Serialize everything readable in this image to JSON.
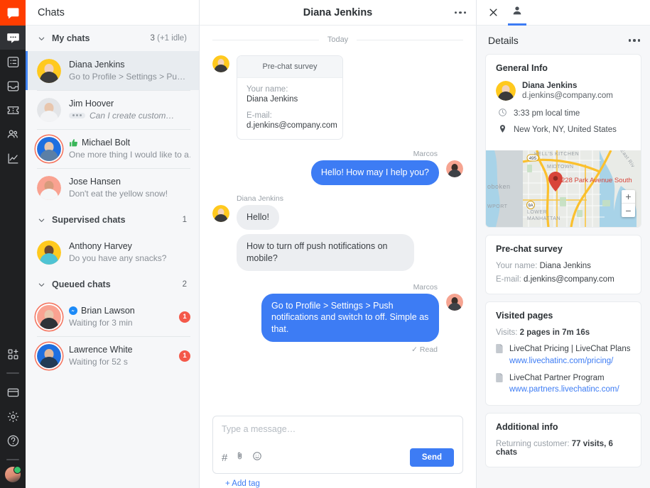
{
  "rail": {
    "logo_icon": "livechat-logo-icon",
    "items": [
      {
        "icon": "chats-bubble-icon",
        "name": "rail-item-chats",
        "active": true
      },
      {
        "icon": "list-icon",
        "name": "rail-item-archives",
        "active": false
      },
      {
        "icon": "inbox-tray-icon",
        "name": "rail-item-tickets",
        "active": false
      },
      {
        "icon": "ticket-icon",
        "name": "rail-item-tickets-2",
        "active": false
      },
      {
        "icon": "people-icon",
        "name": "rail-item-traffic",
        "active": false
      },
      {
        "icon": "chart-line-icon",
        "name": "rail-item-reports",
        "active": false
      }
    ],
    "bottom_items": [
      {
        "icon": "add-apps-icon",
        "name": "rail-item-apps"
      },
      {
        "icon": "card-icon",
        "name": "rail-item-billing"
      },
      {
        "icon": "gear-icon",
        "name": "rail-item-settings"
      },
      {
        "icon": "question-circle-icon",
        "name": "rail-item-help"
      }
    ],
    "avatar_status": "online"
  },
  "chatlist": {
    "header": "Chats",
    "groups": [
      {
        "title": "My chats",
        "count": "3",
        "count_muted": "(+1 idle)",
        "rows": [
          {
            "name": "Diana Jenkins",
            "preview": "Go to Profile > Settings > Pu…",
            "selected": true,
            "ring": false,
            "typing": false,
            "badge": null,
            "prefix_icon": null,
            "av_bg": "#ffc91e",
            "av_face": "#f2d2bb",
            "av_body": "#3b3b3b"
          },
          {
            "name": "Jim Hoover",
            "preview": "Can I create custom…",
            "selected": false,
            "ring": false,
            "typing": true,
            "badge": null,
            "prefix_icon": null,
            "av_bg": "#e3e5e8",
            "av_face": "#e8c6ad",
            "av_body": "#f2f3f5"
          },
          {
            "name": "Michael Bolt",
            "preview": "One more thing I would like to a…",
            "selected": false,
            "ring": true,
            "typing": false,
            "badge": null,
            "prefix_icon": "thumbs-up-icon",
            "av_bg": "#1f6fe0",
            "av_face": "#e8c6ad",
            "av_body": "#5b7fa6"
          },
          {
            "name": "Jose Hansen",
            "preview": "Don't eat the yellow snow!",
            "selected": false,
            "ring": false,
            "typing": false,
            "badge": null,
            "prefix_icon": null,
            "av_bg": "#f9a291",
            "av_face": "#d79b7c",
            "av_body": "#f4f6f7"
          }
        ]
      },
      {
        "title": "Supervised chats",
        "count": "1",
        "count_muted": "",
        "rows": [
          {
            "name": "Anthony Harvey",
            "preview": "Do you have any snacks?",
            "selected": false,
            "ring": false,
            "typing": false,
            "badge": null,
            "prefix_icon": null,
            "av_bg": "#ffc91e",
            "av_face": "#6b4a33",
            "av_body": "#4fc3d4"
          }
        ]
      },
      {
        "title": "Queued chats",
        "count": "2",
        "count_muted": "",
        "rows": [
          {
            "name": "Brian Lawson",
            "preview": "Waiting for 3 min",
            "selected": false,
            "ring": true,
            "typing": false,
            "badge": "1",
            "prefix_icon": "messenger-icon",
            "av_bg": "#f9a291",
            "av_face": "#e8c6ad",
            "av_body": "#2e3338"
          },
          {
            "name": "Lawrence White",
            "preview": "Waiting for 52 s",
            "selected": false,
            "ring": true,
            "typing": false,
            "badge": "1",
            "prefix_icon": null,
            "av_bg": "#1f6fe0",
            "av_face": "#e0b79a",
            "av_body": "#243b55"
          }
        ]
      }
    ]
  },
  "feed": {
    "title": "Diana Jenkins",
    "more_icon": "more-horizontal-icon",
    "day_divider": "Today",
    "survey": {
      "heading": "Pre-chat survey",
      "name_label": "Your name:",
      "name_value": "Diana Jenkins",
      "email_label": "E-mail:",
      "email_value": "d.jenkins@company.com"
    },
    "messages": [
      {
        "sender": "Marcos",
        "side": "out",
        "text": "Hello! How may I help you?"
      },
      {
        "sender": "Diana Jenkins",
        "side": "in",
        "text": "Hello!"
      },
      {
        "sender": "",
        "side": "in",
        "text": "How to turn off push notifications on mobile?"
      },
      {
        "sender": "Marcos",
        "side": "out",
        "text": "Go to Profile > Settings > Push notifications and switch to off. Simple as that."
      }
    ],
    "read_status": "Read",
    "read_icon": "check-icon",
    "composer": {
      "placeholder": "Type a message…",
      "send_label": "Send",
      "icons": [
        "hash-icon",
        "paperclip-icon",
        "emoji-icon"
      ]
    },
    "add_tag": "+ Add tag"
  },
  "details": {
    "close_icon": "close-icon",
    "person_tab_icon": "person-icon",
    "title": "Details",
    "more_icon": "more-horizontal-icon",
    "general_info": {
      "heading": "General Info",
      "name": "Diana Jenkins",
      "email": "d.jenkins@company.com",
      "time_icon": "clock-icon",
      "time": "3:33 pm local time",
      "location_icon": "pin-icon",
      "location": "New York, NY, United States"
    },
    "map": {
      "pin_label": "228 Park Avenue South",
      "zoom_in": "+",
      "zoom_out": "−",
      "labels": [
        "HELL'S KITCHEN",
        "MIDTOWN",
        "oboken",
        "WPORT",
        "LOWER MANHATTAN",
        "495",
        "9A"
      ]
    },
    "prechat": {
      "heading": "Pre-chat survey",
      "name_label": "Your name:",
      "name_value": "Diana Jenkins",
      "email_label": "E-mail:",
      "email_value": "d.jenkins@company.com"
    },
    "visited": {
      "heading": "Visited pages",
      "visits_label": "Visits:",
      "visits_value": "2 pages in 7m 16s",
      "pages": [
        {
          "title": "LiveChat Pricing | LiveChat Plans",
          "url": "www.livechatinc.com/pricing/"
        },
        {
          "title": "LiveChat Partner Program",
          "url": "www.partners.livechatinc.com/"
        }
      ]
    },
    "additional": {
      "heading": "Additional info",
      "line_label": "Returning customer:",
      "line_value": "77 visits, 6 chats"
    }
  },
  "colors": {
    "brand_orange": "#ff3d00",
    "accent_blue": "#3d7cf4",
    "badge_red": "#f4594a",
    "rail_dark": "#1f2022"
  }
}
